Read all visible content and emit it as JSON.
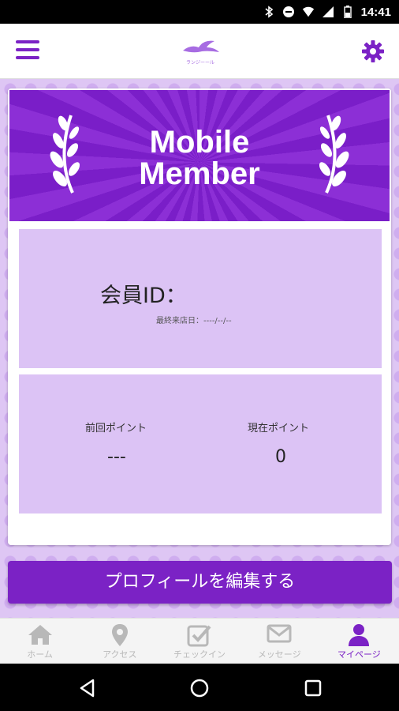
{
  "status_bar": {
    "time": "14:41"
  },
  "header": {
    "menu_icon": "hamburger-icon",
    "logo_text": "ランジーール",
    "settings_icon": "gear-icon"
  },
  "banner": {
    "title_line1": "Mobile",
    "title_line2": "Member"
  },
  "member": {
    "id_label": "会員ID：",
    "last_visit": "最終来店日：----/--/--"
  },
  "points": {
    "previous_label": "前回ポイント",
    "previous_value": "---",
    "current_label": "現在ポイント",
    "current_value": "0"
  },
  "edit_profile_button": "プロフィールを編集する",
  "tabs": [
    {
      "label": "ホーム",
      "icon": "home-icon"
    },
    {
      "label": "アクセス",
      "icon": "location-pin-icon"
    },
    {
      "label": "チェックイン",
      "icon": "checkin-icon"
    },
    {
      "label": "メッセージ",
      "icon": "envelope-icon"
    },
    {
      "label": "マイページ",
      "icon": "person-icon"
    }
  ],
  "colors": {
    "accent": "#7b22c5",
    "panel": "#dcc3f5",
    "background": "#dec6f4",
    "tab_inactive": "#b8b8b8"
  }
}
